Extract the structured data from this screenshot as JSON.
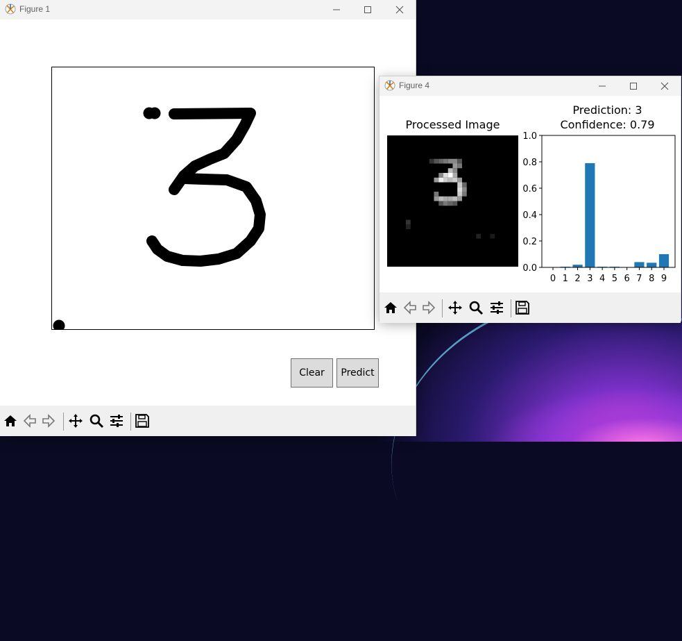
{
  "figure1": {
    "title": "Figure 1",
    "buttons": {
      "clear": "Clear",
      "predict": "Predict"
    },
    "drawing_label": "3"
  },
  "figure4": {
    "title": "Figure 4",
    "image_title": "Processed Image",
    "prediction_line": "Prediction: 3",
    "confidence_line": "Confidence: 0.79"
  },
  "toolbar_icons": [
    "home-icon",
    "back-icon",
    "forward-icon",
    "pan-icon",
    "zoom-icon",
    "configure-icon",
    "save-icon"
  ],
  "chart_data": {
    "type": "bar",
    "categories": [
      "0",
      "1",
      "2",
      "3",
      "4",
      "5",
      "6",
      "7",
      "8",
      "9"
    ],
    "values": [
      0.0,
      0.005,
      0.02,
      0.79,
      0.005,
      0.005,
      0.0,
      0.04,
      0.035,
      0.1
    ],
    "ylim": [
      0,
      1.0
    ],
    "yticks": [
      "0.0",
      "0.2",
      "0.4",
      "0.6",
      "0.8",
      "1.0"
    ],
    "title": "Prediction: 3\nConfidence: 0.79",
    "bar_color": "#1f77b4"
  }
}
